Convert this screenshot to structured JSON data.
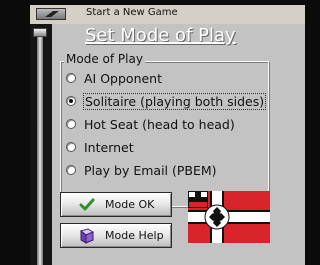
{
  "window": {
    "title": "Start a New Game"
  },
  "dialog": {
    "title": "Set Mode of Play",
    "group_label": "Mode of Play",
    "options": [
      {
        "label": "AI Opponent",
        "selected": false
      },
      {
        "label": "Solitaire (playing both sides)",
        "selected": true
      },
      {
        "label": "Hot Seat (head to head)",
        "selected": false
      },
      {
        "label": "Internet",
        "selected": false
      },
      {
        "label": "Play by Email (PBEM)",
        "selected": false
      }
    ],
    "buttons": {
      "ok_label": "Mode OK",
      "help_label": "Mode Help"
    }
  },
  "colors": {
    "panel": "#c3c3c3",
    "title_text": "#ffffff",
    "flag_red": "#d8232a",
    "flag_black": "#111111",
    "check_green": "#2f8f2f"
  },
  "icons": {
    "ok": "checkmark-icon",
    "help": "book-icon",
    "flag": "iron-cross-war-ensign"
  }
}
